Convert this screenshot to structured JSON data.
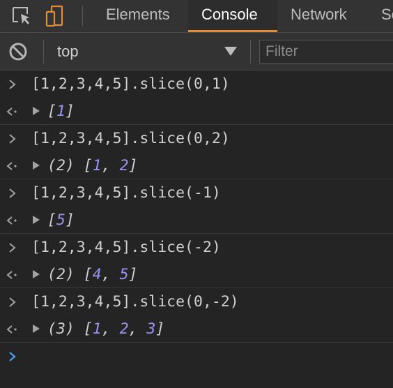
{
  "tabs": [
    {
      "label": "Elements",
      "active": false
    },
    {
      "label": "Console",
      "active": true
    },
    {
      "label": "Network",
      "active": false
    },
    {
      "label": "So",
      "active": false
    }
  ],
  "toolbar": {
    "context": "top",
    "filter_placeholder": "Filter"
  },
  "console": {
    "entries": [
      {
        "input": "[1,2,3,4,5].slice(0,1)",
        "result_count": "",
        "result_values": [
          "1"
        ]
      },
      {
        "input": "[1,2,3,4,5].slice(0,2)",
        "result_count": "(2)",
        "result_values": [
          "1",
          "2"
        ]
      },
      {
        "input": "[1,2,3,4,5].slice(-1)",
        "result_count": "",
        "result_values": [
          "5"
        ]
      },
      {
        "input": "[1,2,3,4,5].slice(-2)",
        "result_count": "(2)",
        "result_values": [
          "4",
          "5"
        ]
      },
      {
        "input": "[1,2,3,4,5].slice(0,-2)",
        "result_count": "(3)",
        "result_values": [
          "1",
          "2",
          "3"
        ]
      }
    ]
  },
  "colors": {
    "background": "#242424",
    "toolbar": "#333333",
    "active_tab_underline": "#e08e3a",
    "number": "#9b95f2",
    "prompt": "#4c9ef5"
  },
  "icons": {
    "inspect": "element-picker-icon",
    "device": "device-toolbar-icon",
    "clear": "clear-console-icon",
    "input_prompt": "chevron-right-icon",
    "output_marker": "return-arrow-icon",
    "expand": "triangle-right-icon",
    "dropdown": "triangle-down-icon"
  }
}
